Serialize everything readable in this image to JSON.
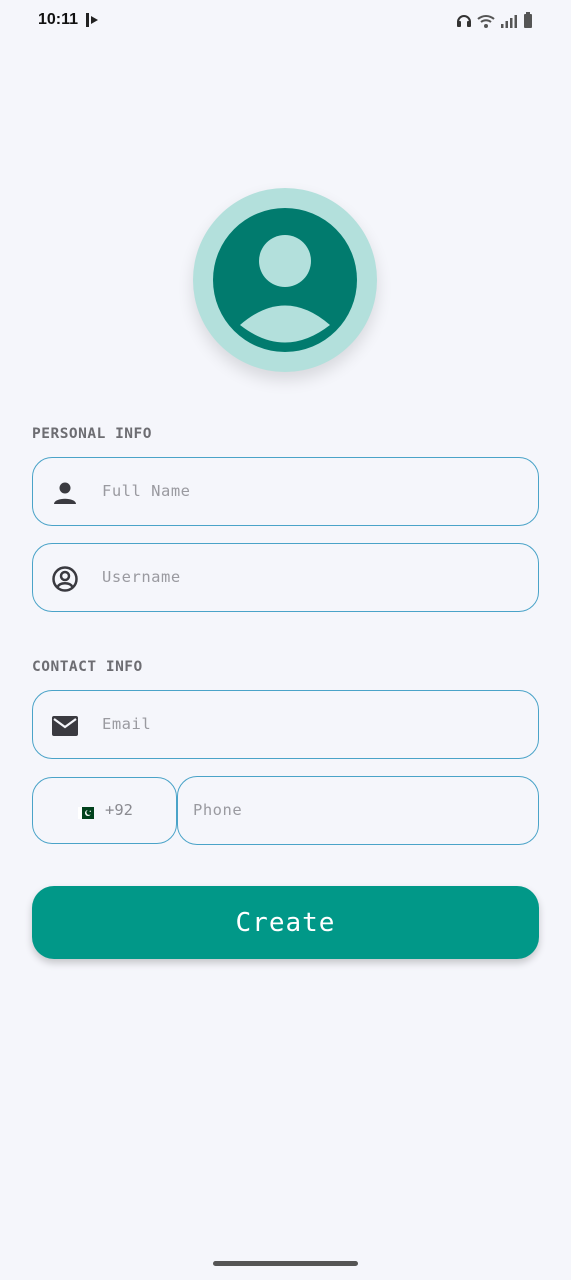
{
  "status_bar": {
    "time": "10:11",
    "icons": [
      "app-notification-icon",
      "headphones-icon",
      "wifi-icon",
      "signal-icon",
      "battery-icon"
    ]
  },
  "avatar": {
    "icon": "person-avatar-icon",
    "ring_color": "#b3e0dc",
    "fill_color": "#017b6e"
  },
  "personal_info": {
    "label": "PERSONAL INFO",
    "full_name": {
      "placeholder": "Full Name",
      "icon": "person-icon"
    },
    "username": {
      "placeholder": "Username",
      "icon": "account-circle-icon"
    }
  },
  "contact_info": {
    "label": "CONTACT INFO",
    "email": {
      "placeholder": "Email",
      "icon": "mail-icon"
    },
    "country_code": {
      "flag": "pakistan-flag-icon",
      "code": "+92"
    },
    "phone": {
      "placeholder": "Phone"
    }
  },
  "actions": {
    "create_label": "Create",
    "accent": "#019888"
  },
  "colors": {
    "border": "#4aa3c8",
    "background": "#f5f6fb"
  }
}
